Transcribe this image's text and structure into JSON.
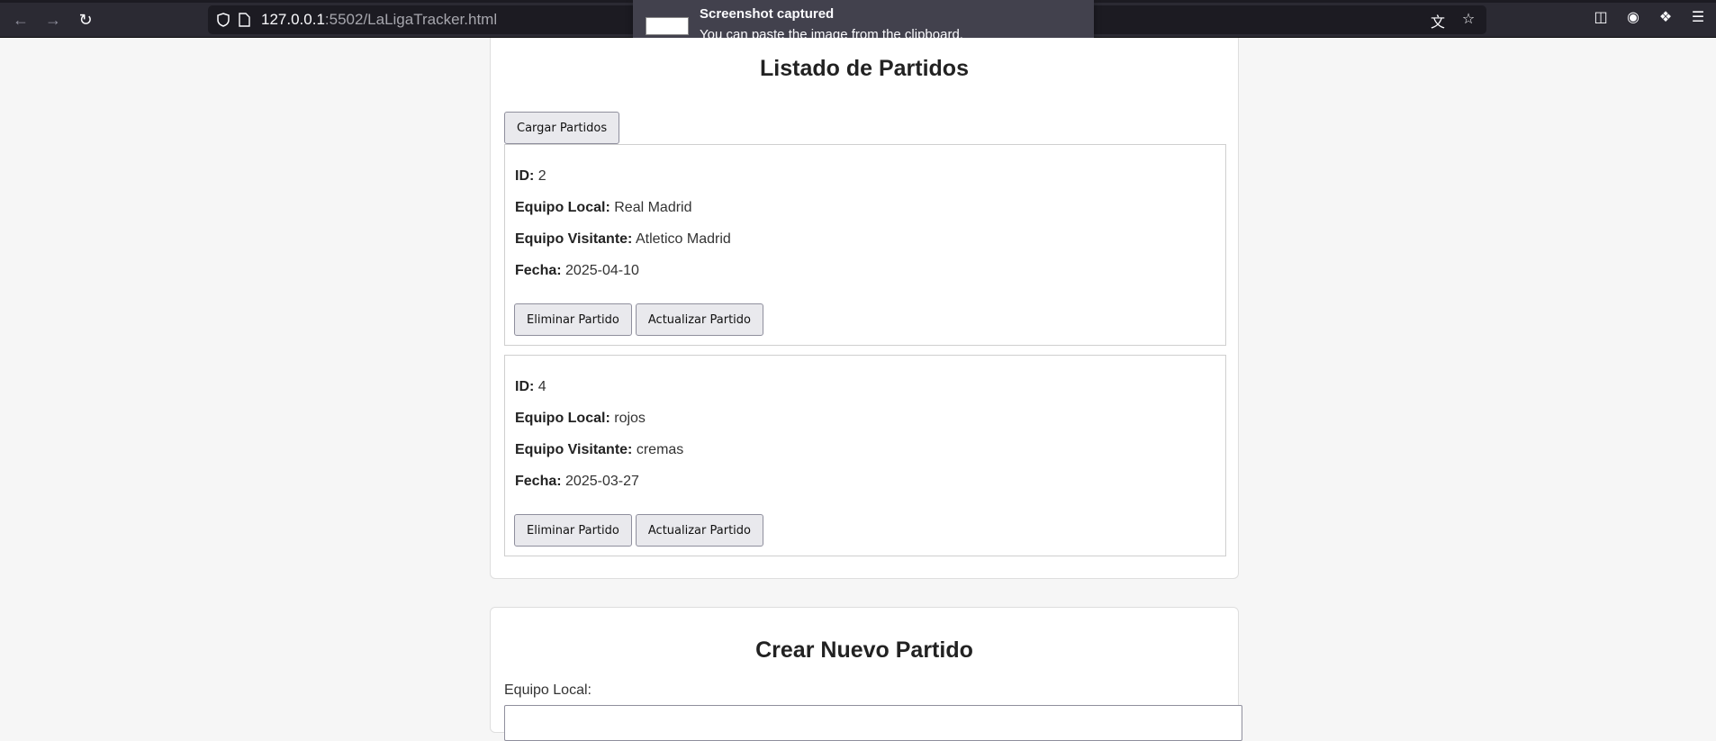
{
  "browser": {
    "url_host": "127.0.0.1",
    "url_rest": ":5502/LaLigaTracker.html"
  },
  "notification": {
    "title": "Screenshot captured",
    "message": "You can paste the image from the clipboard."
  },
  "listado": {
    "title": "Listado de Partidos",
    "load_button": "Cargar Partidos",
    "labels": {
      "id": "ID:",
      "local": "Equipo Local:",
      "visitante": "Equipo Visitante:",
      "fecha": "Fecha:"
    },
    "delete_label": "Eliminar Partido",
    "update_label": "Actualizar Partido",
    "matches": [
      {
        "id": "2",
        "local": "Real Madrid",
        "visitante": "Atletico Madrid",
        "fecha": "2025-04-10"
      },
      {
        "id": "4",
        "local": "rojos",
        "visitante": "cremas",
        "fecha": "2025-03-27"
      }
    ]
  },
  "crear": {
    "title": "Crear Nuevo Partido",
    "local_label": "Equipo Local:"
  }
}
